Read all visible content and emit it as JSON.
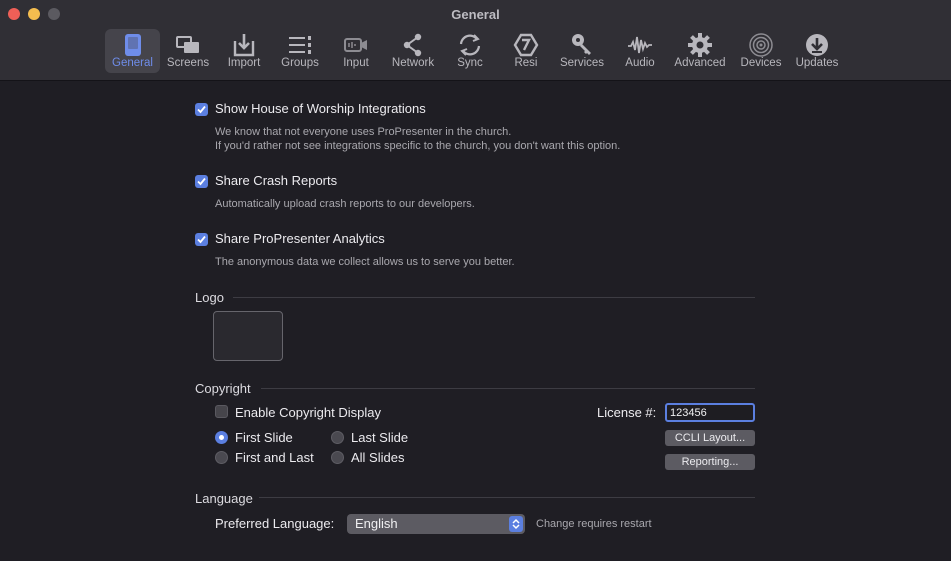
{
  "window": {
    "title": "General"
  },
  "toolbar": {
    "items": [
      {
        "label": "General",
        "icon": "general-icon",
        "active": true
      },
      {
        "label": "Screens",
        "icon": "screens-icon"
      },
      {
        "label": "Import",
        "icon": "import-icon"
      },
      {
        "label": "Groups",
        "icon": "groups-icon"
      },
      {
        "label": "Input",
        "icon": "input-icon"
      },
      {
        "label": "Network",
        "icon": "network-icon"
      },
      {
        "label": "Sync",
        "icon": "sync-icon"
      },
      {
        "label": "Resi",
        "icon": "resi-icon"
      },
      {
        "label": "Services",
        "icon": "services-icon"
      },
      {
        "label": "Audio",
        "icon": "audio-icon"
      },
      {
        "label": "Advanced",
        "icon": "advanced-icon"
      },
      {
        "label": "Devices",
        "icon": "devices-icon"
      },
      {
        "label": "Updates",
        "icon": "updates-icon"
      }
    ]
  },
  "options": {
    "worship": {
      "label": "Show House of Worship Integrations",
      "checked": true,
      "desc_line1": "We know that not everyone uses ProPresenter in the church.",
      "desc_line2": "If you'd rather not see integrations specific to the church, you don't want this option."
    },
    "crash": {
      "label": "Share Crash Reports",
      "checked": true,
      "desc": "Automatically upload crash reports to our developers."
    },
    "analytics": {
      "label": "Share ProPresenter Analytics",
      "checked": true,
      "desc": "The anonymous data we collect allows us to serve you better."
    }
  },
  "logo": {
    "title": "Logo"
  },
  "copyright": {
    "title": "Copyright",
    "enable_label": "Enable Copyright Display",
    "enable_checked": false,
    "placement_options": [
      "First Slide",
      "Last Slide",
      "First and Last",
      "All Slides"
    ],
    "placement_selected": "First Slide",
    "license_label": "License #:",
    "license_value": "123456",
    "ccli_button": "CCLI Layout...",
    "reporting_button": "Reporting..."
  },
  "language": {
    "title": "Language",
    "preferred_label": "Preferred Language:",
    "selected": "English",
    "note": "Change requires restart"
  },
  "colors": {
    "accent": "#5b7fe0",
    "background": "#1f1e24",
    "titlebar": "#302f35"
  }
}
